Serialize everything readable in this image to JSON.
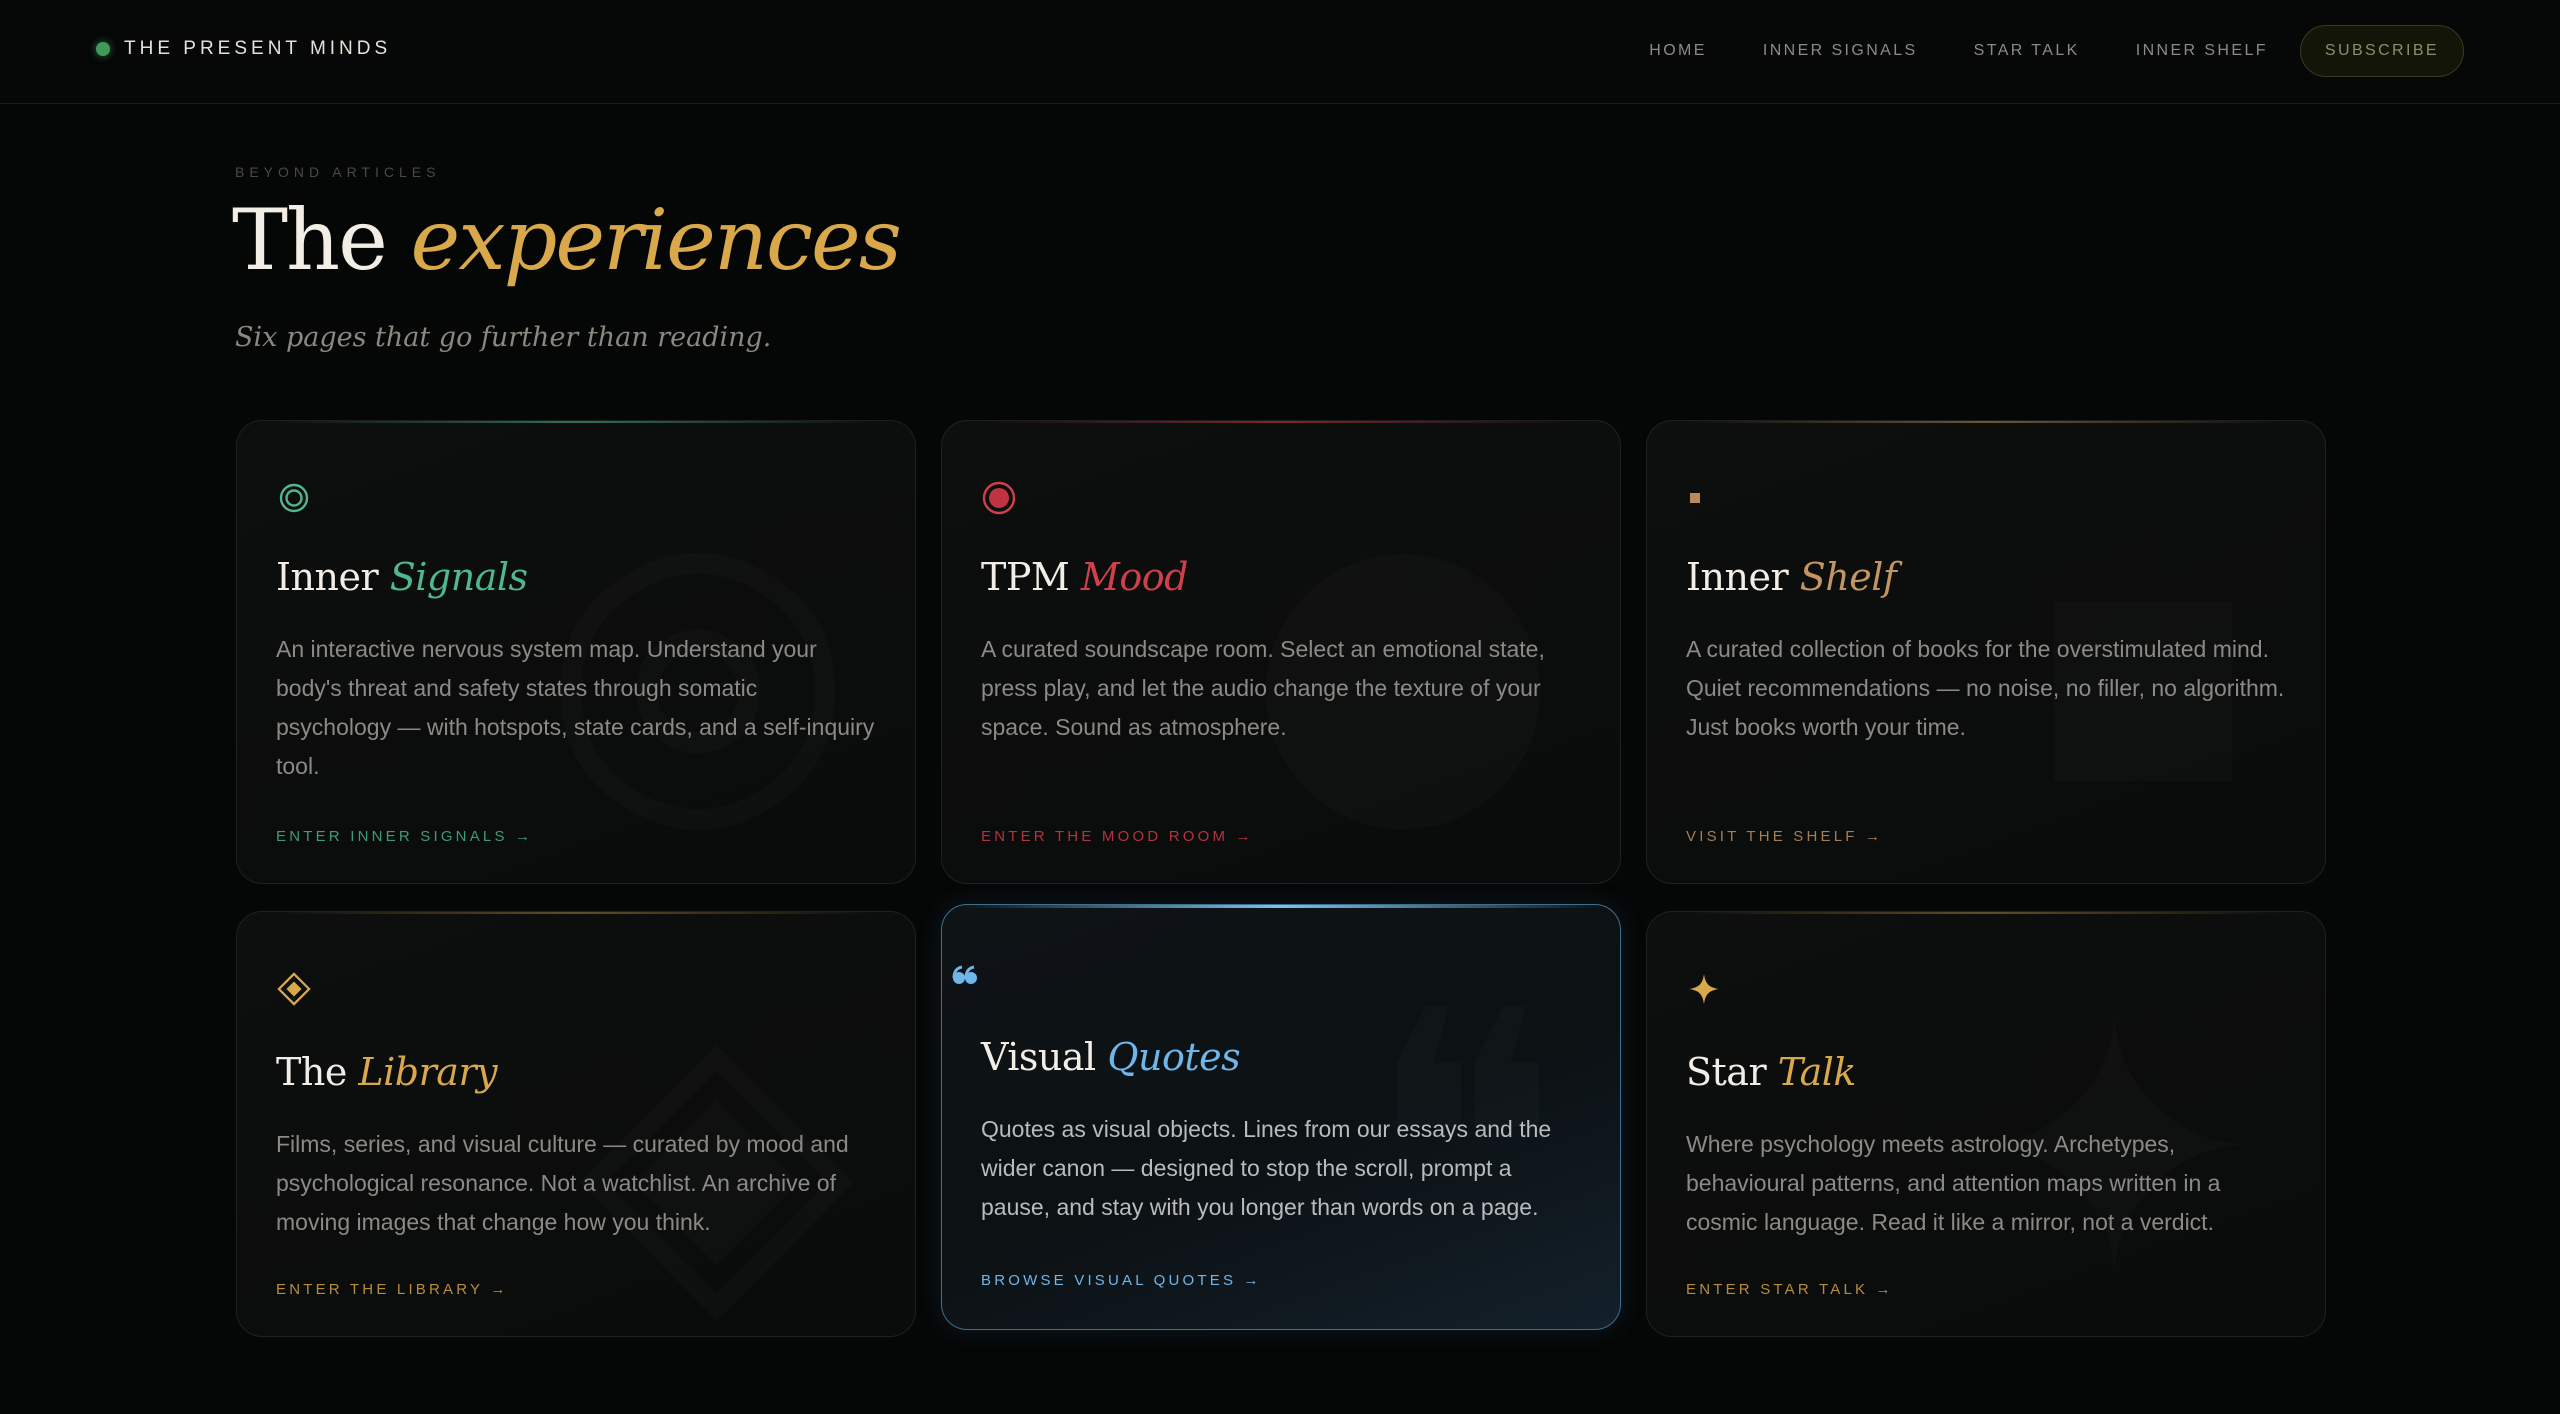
{
  "brand": {
    "name": "THE PRESENT MINDS",
    "dot_color": "#3f9a5b"
  },
  "nav": {
    "links": [
      "HOME",
      "INNER SIGNALS",
      "STAR TALK",
      "INNER SHELF"
    ],
    "subscribe_label": "SUBSCRIBE"
  },
  "hero": {
    "eyebrow": "BEYOND ARTICLES",
    "title_plain": "The",
    "title_accent": "experiences",
    "subtitle": "Six pages that go further than reading."
  },
  "cards": [
    {
      "icon": "ring-icon",
      "title_plain": "Inner",
      "title_accent": "Signals",
      "accent_color": "#4fb88e",
      "description": "An interactive nervous system map. Understand your body's threat and safety states through somatic psychology — with hotspots, state cards, and a self-inquiry tool.",
      "cta": "ENTER INNER SIGNALS →"
    },
    {
      "icon": "record-dot-icon",
      "title_plain": "TPM",
      "title_accent": "Mood",
      "accent_color": "#d0404c",
      "description": "A curated soundscape room. Select an emotional state, press play, and let the audio change the texture of your space. Sound as atmosphere.",
      "cta": "ENTER THE MOOD ROOM →"
    },
    {
      "icon": "small-square-icon",
      "title_plain": "Inner",
      "title_accent": "Shelf",
      "accent_color": "#c49562",
      "description": "A curated collection of books for the overstimulated mind. Quiet recommendations — no noise, no filler, no algorithm. Just books worth your time.",
      "cta": "VISIT THE SHELF →"
    },
    {
      "icon": "diamond-icon",
      "title_plain": "The",
      "title_accent": "Library",
      "accent_color": "#d8a84a",
      "description": "Films, series, and visual culture — curated by mood and psychological resonance. Not a watchlist. An archive of moving images that change how you think.",
      "cta": "ENTER THE LIBRARY →"
    },
    {
      "icon": "quote-icon",
      "title_plain": "Visual",
      "title_accent": "Quotes",
      "accent_color": "#6fb6ea",
      "description": "Quotes as visual objects. Lines from our essays and the wider canon — designed to stop the scroll, prompt a pause, and stay with you longer than words on a page.",
      "cta": "BROWSE VISUAL QUOTES →"
    },
    {
      "icon": "sparkle-star-icon",
      "title_plain": "Star",
      "title_accent": "Talk",
      "accent_color": "#d8a84a",
      "description": "Where psychology meets astrology. Archetypes, behavioural patterns, and attention maps written in a cosmic language. Read it like a mirror, not a verdict.",
      "cta": "ENTER STAR TALK →"
    }
  ]
}
